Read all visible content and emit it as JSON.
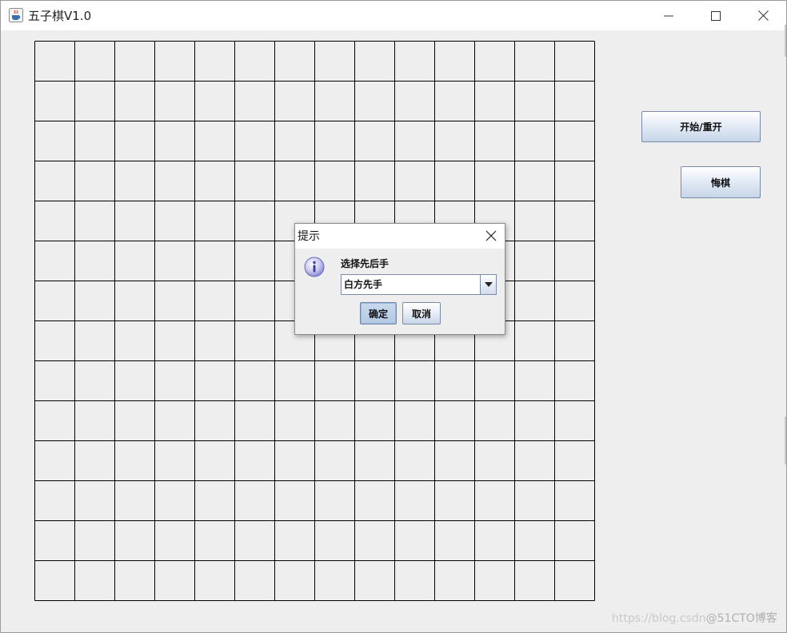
{
  "window": {
    "title": "五子棋V1.0",
    "icon": "java-cup-icon",
    "controls": [
      "minimize-icon",
      "maximize-icon",
      "close-icon"
    ]
  },
  "board": {
    "rows": 14,
    "cols": 14,
    "line_color": "#000000"
  },
  "sidebar": {
    "start_restart_label": "开始/重开",
    "undo_label": "悔棋"
  },
  "dialog": {
    "title": "提示",
    "icon": "info-icon",
    "prompt": "选择先后手",
    "select": {
      "selected": "白方先手"
    },
    "ok_label": "确定",
    "cancel_label": "取消"
  },
  "watermark": {
    "text": "https://blog.csdn",
    "text2": "@51CTO博客"
  },
  "colors": {
    "background": "#eeeeee",
    "button_gradient_bottom": "#c6d5e8",
    "button_border": "#7a8aa6"
  }
}
